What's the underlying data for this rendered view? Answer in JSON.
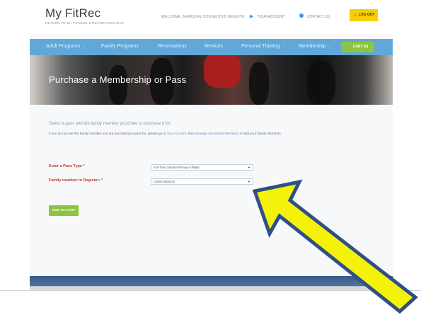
{
  "header": {
    "logo": "My FitRec",
    "logo_sub": "RETURN TO BU FITNESS & RECREATION SITE",
    "welcome": "WELCOME, MARISCAL HOUSEHOLD REGISTE",
    "account": "YOUR ACCOUNT",
    "contact": "CONTACT US",
    "logout": "LOG OUT"
  },
  "nav": {
    "items": [
      "Adult Programs",
      "Family Programs",
      "Reservations",
      "Services",
      "Personal Training",
      "Membership"
    ],
    "cart": "CART (0)"
  },
  "hero": {
    "title": "Purchase a Membership or Pass"
  },
  "content": {
    "intro": "Select a pass and the family member you'd like to purchase it for.",
    "note_prefix": "If you do not see the family member you are purchasing a pass for, please go to ",
    "note_link1": "Your Account",
    "note_middle": ", then ",
    "note_link2": "Manage Household Members",
    "note_suffix": " to add your family members."
  },
  "form": {
    "pass_label": "Enter a Pass Type *",
    "pass_value": "Full-Time Student Primary Affiliate",
    "member_label": "Family member to Register: *",
    "member_value": "Carlos Mariscal",
    "add_to_cart": "ADD TO CART"
  },
  "colors": {
    "nav": "#5fa8d8",
    "logout": "#f5d000",
    "green": "#8bc53f",
    "label_red": "#c0392b",
    "arrow_fill": "#f5f20a",
    "arrow_stroke": "#2f4f86"
  }
}
